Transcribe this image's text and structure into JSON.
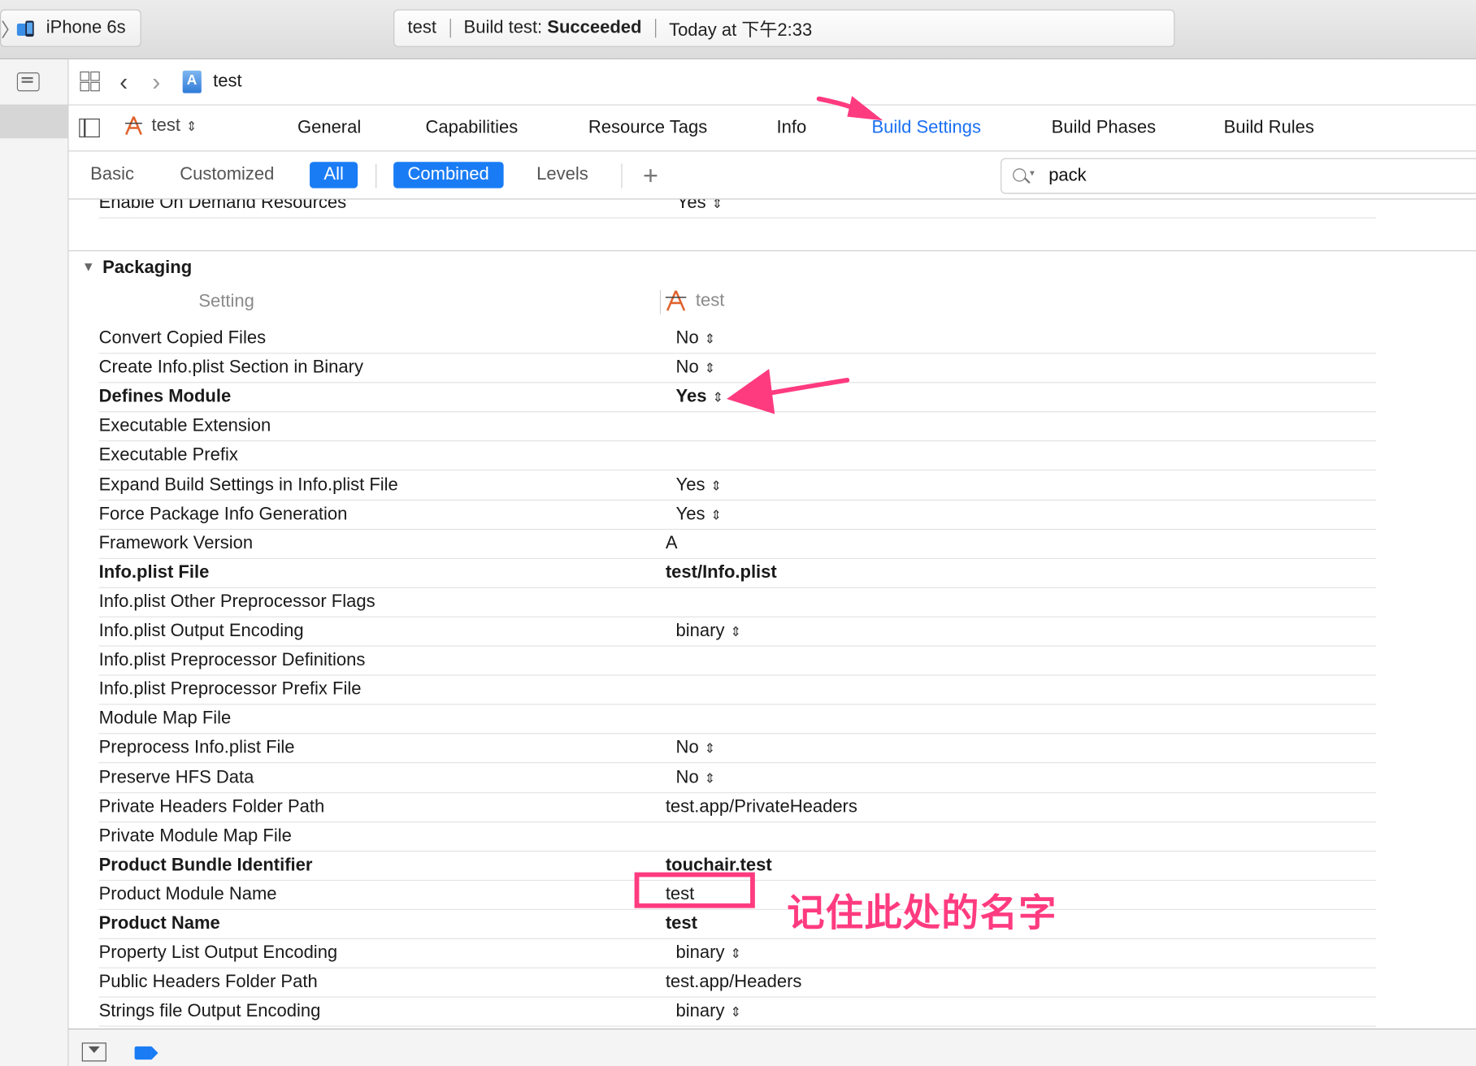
{
  "titlebar": {
    "scheme_chevron": "〉",
    "device": "iPhone 6s",
    "activity_project": "test",
    "activity_status_prefix": "Build test: ",
    "activity_status_result": "Succeeded",
    "activity_time": "Today at 下午2:33"
  },
  "jumpbar": {
    "back_icon": "‹",
    "forward_icon": "›",
    "project": "test"
  },
  "tabbar": {
    "target": "test",
    "target_updown": "⌃⌄",
    "tabs": [
      "General",
      "Capabilities",
      "Resource Tags",
      "Info",
      "Build Settings",
      "Build Phases",
      "Build Rules"
    ],
    "active_tab": "Build Settings"
  },
  "filterbar": {
    "basic": "Basic",
    "customized": "Customized",
    "all": "All",
    "combined": "Combined",
    "levels": "Levels",
    "add": "+",
    "search_value": "pack",
    "clear_icon": "×"
  },
  "content": {
    "partial_row": {
      "name": "Enable On Demand Resources",
      "value": "Yes"
    },
    "section_title": "Packaging",
    "section_triangle": "▼",
    "col_setting": "Setting",
    "col_target": "test",
    "rows": [
      {
        "name": "Convert Copied Files",
        "value": "No",
        "stepper": true,
        "bold": false
      },
      {
        "name": "Create Info.plist Section in Binary",
        "value": "No",
        "stepper": true,
        "bold": false
      },
      {
        "name": "Defines Module",
        "value": "Yes",
        "stepper": true,
        "bold": true
      },
      {
        "name": "Executable Extension",
        "value": "",
        "stepper": false,
        "bold": false
      },
      {
        "name": "Executable Prefix",
        "value": "",
        "stepper": false,
        "bold": false
      },
      {
        "name": "Expand Build Settings in Info.plist File",
        "value": "Yes",
        "stepper": true,
        "bold": false
      },
      {
        "name": "Force Package Info Generation",
        "value": "Yes",
        "stepper": true,
        "bold": false
      },
      {
        "name": "Framework Version",
        "value": "A",
        "stepper": false,
        "bold": false
      },
      {
        "name": "Info.plist File",
        "value": "test/Info.plist",
        "stepper": false,
        "bold": true
      },
      {
        "name": "Info.plist Other Preprocessor Flags",
        "value": "",
        "stepper": false,
        "bold": false
      },
      {
        "name": "Info.plist Output Encoding",
        "value": "binary",
        "stepper": true,
        "bold": false
      },
      {
        "name": "Info.plist Preprocessor Definitions",
        "value": "",
        "stepper": false,
        "bold": false
      },
      {
        "name": "Info.plist Preprocessor Prefix File",
        "value": "",
        "stepper": false,
        "bold": false
      },
      {
        "name": "Module Map File",
        "value": "",
        "stepper": false,
        "bold": false
      },
      {
        "name": "Preprocess Info.plist File",
        "value": "No",
        "stepper": true,
        "bold": false
      },
      {
        "name": "Preserve HFS Data",
        "value": "No",
        "stepper": true,
        "bold": false
      },
      {
        "name": "Private Headers Folder Path",
        "value": "test.app/PrivateHeaders",
        "stepper": false,
        "bold": false
      },
      {
        "name": "Private Module Map File",
        "value": "",
        "stepper": false,
        "bold": false
      },
      {
        "name": "Product Bundle Identifier",
        "value": "touchair.test",
        "stepper": false,
        "bold": true
      },
      {
        "name": "Product Module Name",
        "value": "test",
        "stepper": false,
        "bold": false
      },
      {
        "name": "Product Name",
        "value": "test",
        "stepper": false,
        "bold": true
      },
      {
        "name": "Property List Output Encoding",
        "value": "binary",
        "stepper": true,
        "bold": false
      },
      {
        "name": "Public Headers Folder Path",
        "value": "test.app/Headers",
        "stepper": false,
        "bold": false
      },
      {
        "name": "Strings file Output Encoding",
        "value": "binary",
        "stepper": true,
        "bold": false
      }
    ],
    "stepper_glyph": "⌃⌄"
  },
  "annotation": {
    "text": "记住此处的名字",
    "color": "#ff3b7f"
  },
  "colors": {
    "accent": "#1a7cf5",
    "active_tab": "#1a6ff2",
    "annotation": "#ff3b7f"
  }
}
